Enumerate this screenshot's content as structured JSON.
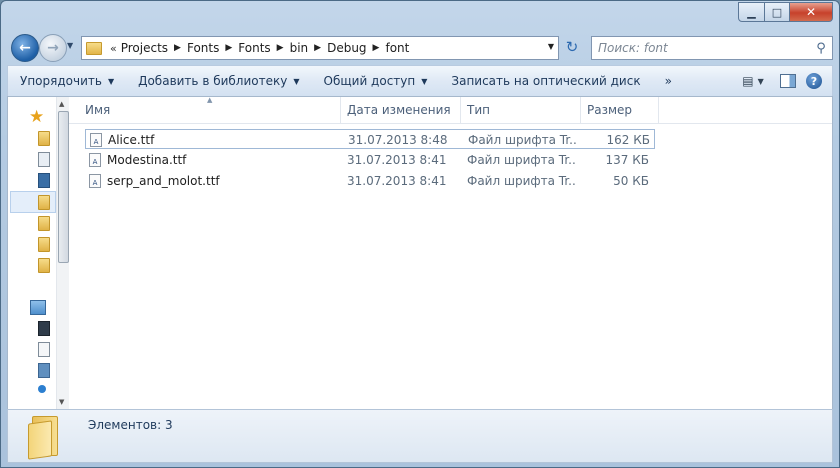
{
  "window": {
    "controls": {
      "minimize": "▁",
      "maximize": "□",
      "close": "✕"
    }
  },
  "nav": {
    "back_icon": "arrow-left-icon",
    "forward_icon": "arrow-right-icon",
    "breadcrumb_prefix": "«",
    "breadcrumbs": [
      "Projects",
      "Fonts",
      "Fonts",
      "bin",
      "Debug",
      "font"
    ],
    "search_placeholder": "Поиск: font"
  },
  "toolbar": {
    "organize": "Упорядочить",
    "add_to_library": "Добавить в библиотеку",
    "share": "Общий доступ",
    "burn": "Записать на оптический диск",
    "more": "»"
  },
  "columns": {
    "name": "Имя",
    "date": "Дата изменения",
    "type": "Тип",
    "size": "Размер"
  },
  "files": [
    {
      "name": "Alice.ttf",
      "date": "31.07.2013 8:48",
      "type": "Файл шрифта Tr...",
      "size": "162 КБ"
    },
    {
      "name": "Modestina.ttf",
      "date": "31.07.2013 8:41",
      "type": "Файл шрифта Tr...",
      "size": "137 КБ"
    },
    {
      "name": "serp_and_molot.ttf",
      "date": "31.07.2013 8:41",
      "type": "Файл шрифта Tr...",
      "size": "50 КБ"
    }
  ],
  "status": {
    "items_count": "Элементов: 3"
  },
  "colors": {
    "accent": "#1e5fa6",
    "selection_border": "#9fb8d6"
  }
}
